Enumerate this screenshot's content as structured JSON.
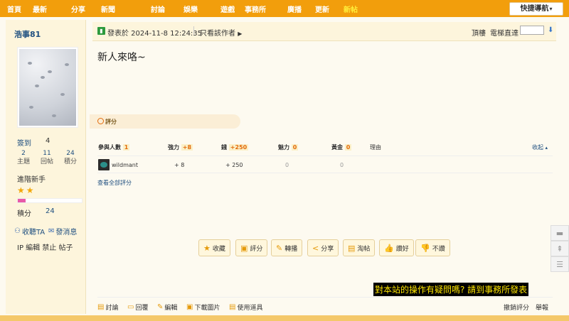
{
  "nav": {
    "items": [
      "首頁",
      "最新",
      "分享",
      "新聞",
      "討論",
      "娛樂",
      "遊戲",
      "事務所",
      "廣播",
      "更新",
      "新帖"
    ],
    "quick_nav_label": "快捷導航"
  },
  "author": {
    "username": "浩事81",
    "stats": {
      "signin_label": "簽到",
      "signin_value": "4",
      "topics_value": "2",
      "topics_label": "主題",
      "replies_value": "11",
      "replies_label": "回帖",
      "points_value": "24",
      "points_label": "積分"
    },
    "level": "進階新手",
    "stars": "★★",
    "credit_progress": 0.12,
    "credits_label": "積分",
    "credits_value": "24",
    "follow_label": "收聽TA",
    "message_label": "發消息",
    "admin_line": "IP 編輯 禁止 帖子"
  },
  "post": {
    "posted_at": "發表於 2024-11-8 12:24:35",
    "only_author": "只看該作者",
    "top_floor": "頂樓",
    "jump_label": "電梯直達",
    "title": "新人來咯~"
  },
  "rating": {
    "tab_label": "評分",
    "headers": {
      "participants_label": "參與人數",
      "participants_count": "1",
      "effort_label": "強力",
      "effort_value": "+8",
      "money_label": "錢",
      "money_value": "+250",
      "charm_label": "魅力",
      "charm_value": "0",
      "gold_label": "黃金",
      "gold_value": "0",
      "reason_label": "理由",
      "collapse_label": "收起"
    },
    "rows": [
      {
        "user": "wildmant",
        "effort": "+ 8",
        "money": "+ 250",
        "charm": "0",
        "gold": "0"
      }
    ],
    "view_all": "查看全部評分"
  },
  "actions": [
    {
      "icon": "star-icon",
      "label": "收藏"
    },
    {
      "icon": "rate-icon",
      "label": "評分"
    },
    {
      "icon": "forward-icon",
      "label": "轉播"
    },
    {
      "icon": "share-icon",
      "label": "分享"
    },
    {
      "icon": "recommend-icon",
      "label": "淘帖"
    },
    {
      "icon": "thumbs-up-icon",
      "label": "讚好"
    },
    {
      "icon": "thumbs-down-icon",
      "label": "不讚"
    }
  ],
  "caption": "對本站的操作有疑問嗎? 請到事務所發表",
  "footer": {
    "links": [
      "討論",
      "回覆",
      "編輯",
      "下載圖片",
      "使用道具"
    ],
    "revoke_rating": "撤銷評分",
    "report": "舉報"
  },
  "colors": {
    "nav_bg": "#f29e0c",
    "accent_orange": "#e36b0a",
    "link_blue": "#205080"
  }
}
